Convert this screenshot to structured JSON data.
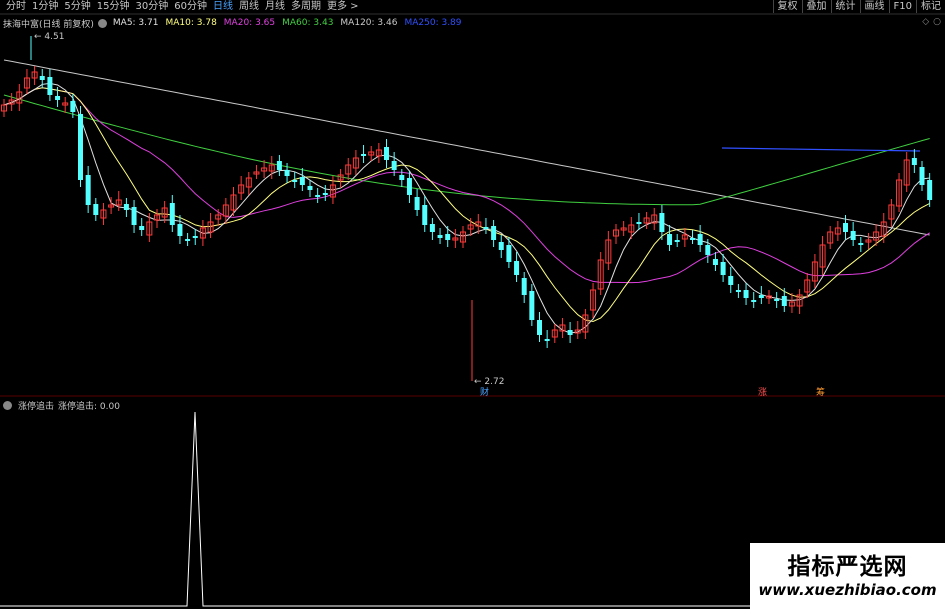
{
  "toolbar": {
    "tabs": [
      "分时",
      "1分钟",
      "5分钟",
      "15分钟",
      "30分钟",
      "60分钟",
      "日线",
      "周线",
      "月线",
      "多周期",
      "更多 >"
    ],
    "active_tab": "日线",
    "tools": [
      "复权",
      "叠加",
      "统计",
      "画线",
      "F10",
      "标记"
    ]
  },
  "info": {
    "name": "抹海中富(日线 前复权)",
    "ma5": "MA5: 3.71",
    "ma10": "MA10: 3.78",
    "ma20": "MA20: 3.65",
    "ma60": "MA60: 3.43",
    "ma120": "MA120: 3.46",
    "ma250": "MA250: 3.89"
  },
  "colors": {
    "up": "#ff3b3b",
    "down": "#54ffff",
    "ma5": "#e0e0e0",
    "ma10": "#ffff80",
    "ma20": "#e040e0",
    "ma60": "#40d040",
    "ma120": "#c8c8c8",
    "ma250": "#3050ff",
    "indicator": "#ffffff"
  },
  "price_axis": {
    "min": 2.72,
    "max": 4.51
  },
  "annotations": {
    "high_label": "4.51",
    "low_label": "2.72",
    "marker_cai": "财",
    "marker_zhang": "涨",
    "marker_chou": "筹"
  },
  "indicator": {
    "name": "涨停追击",
    "value_label": "涨停追击: 0.00"
  },
  "watermark": {
    "title": "指标严选网",
    "url": "www.xuezhibiao.com"
  }
}
